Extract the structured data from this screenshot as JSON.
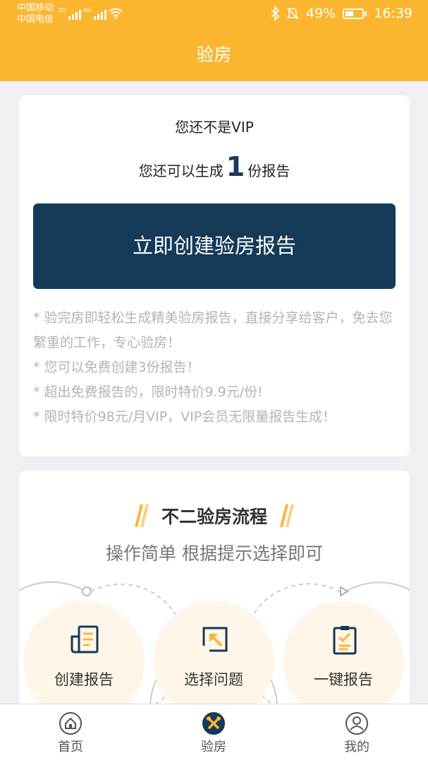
{
  "status_bar": {
    "carrier1": "中国移动",
    "carrier2": "中国电信",
    "net1": "2G",
    "net2": "4G",
    "battery": "49%",
    "battery_level": 0.49,
    "time": "16:39"
  },
  "header": {
    "title": "验房"
  },
  "vip_card": {
    "status": "您还不是VIP",
    "remain_prefix": "您还可以生成",
    "remain_count": "1",
    "remain_suffix": "份报告",
    "create_button": "立即创建验房报告",
    "notes": [
      "* 验完房即轻松生成精美验房报告，直接分享给客户，免去您繁重的工作，专心验房！",
      "* 您可以免费创建3份报告！",
      "* 超出免费报告的，限时特价9.9元/份!",
      "* 限时特价98元/月VIP，VIP会员无限量报告生成！"
    ]
  },
  "process": {
    "title": "不二验房流程",
    "subtitle": "操作简单 根据提示选择即可",
    "steps": [
      {
        "label": "创建报告",
        "icon": "document-icon"
      },
      {
        "label": "选择问题",
        "icon": "select-cursor-icon"
      },
      {
        "label": "一键报告",
        "icon": "checklist-icon"
      }
    ]
  },
  "tabbar": {
    "items": [
      {
        "label": "首页",
        "icon": "home-icon",
        "active": false
      },
      {
        "label": "验房",
        "icon": "tools-icon",
        "active": true
      },
      {
        "label": "我的",
        "icon": "user-icon",
        "active": false
      }
    ]
  },
  "colors": {
    "accent": "#fbb62f",
    "button": "#153a58",
    "step_bg": "#fff6e9"
  }
}
